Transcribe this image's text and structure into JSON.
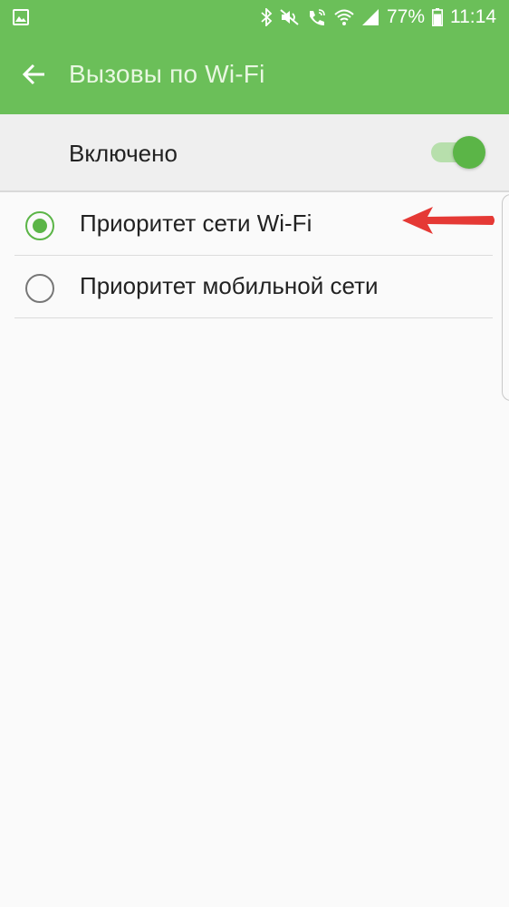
{
  "status_bar": {
    "battery_percent": "77%",
    "time": "11:14",
    "icons": [
      "gallery-icon",
      "bluetooth-icon",
      "mute-icon",
      "wifi-calling-icon",
      "wifi-icon",
      "signal-icon",
      "battery-icon"
    ]
  },
  "app_bar": {
    "title": "Вызовы по Wi-Fi"
  },
  "master_switch": {
    "label": "Включено",
    "on": true
  },
  "options": [
    {
      "label": "Приоритет сети Wi-Fi",
      "selected": true
    },
    {
      "label": "Приоритет мобильной сети",
      "selected": false
    }
  ],
  "colors": {
    "accent": "#6bbf59",
    "switch_on": "#5bb547",
    "annotation": "#e53935"
  }
}
